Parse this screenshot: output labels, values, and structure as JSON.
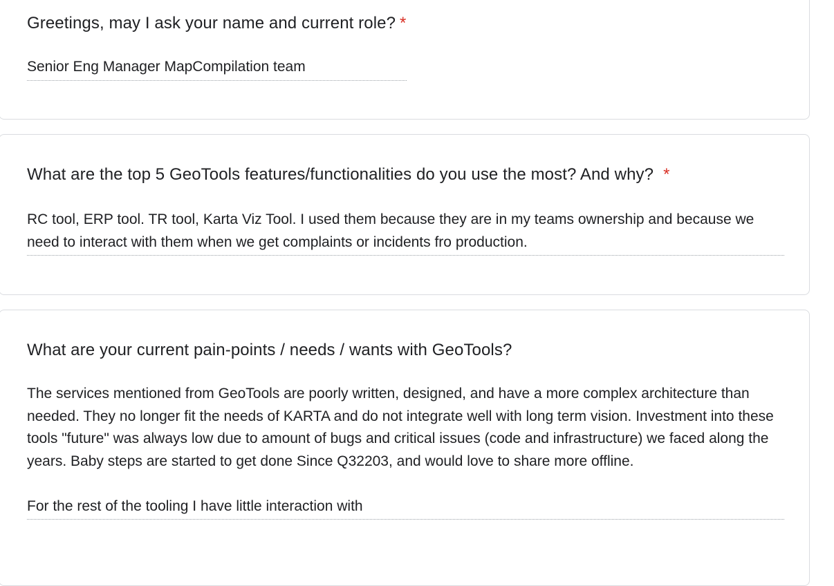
{
  "form": {
    "questions": [
      {
        "title": "Greetings, may I ask your name and current role?",
        "required_mark": "*",
        "answer": "Senior Eng Manager MapCompilation team"
      },
      {
        "title": "What are the top 5 GeoTools features/functionalities do you use the most? And why?",
        "required_mark": "*",
        "answer": "RC tool, ERP tool. TR tool, Karta Viz Tool. I used them because they are in my teams ownership and because we need to interact with them when we get complaints or incidents fro production."
      },
      {
        "title": "What are your current pain-points / needs / wants with GeoTools?",
        "answer": "The services mentioned from GeoTools are poorly written, designed, and have a more complex architecture than needed. They no longer fit the needs of KARTA and do not integrate well with long term vision. Investment into these tools \"future\" was always low due to amount of bugs and critical issues (code and infrastructure) we faced along the years. Baby steps are started to get done Since Q32203, and would love to share more offline.\n\nFor the rest of the tooling I have little interaction with"
      }
    ]
  },
  "colors": {
    "required": "#d93025",
    "card_border": "#dadce0",
    "text": "#202124"
  }
}
